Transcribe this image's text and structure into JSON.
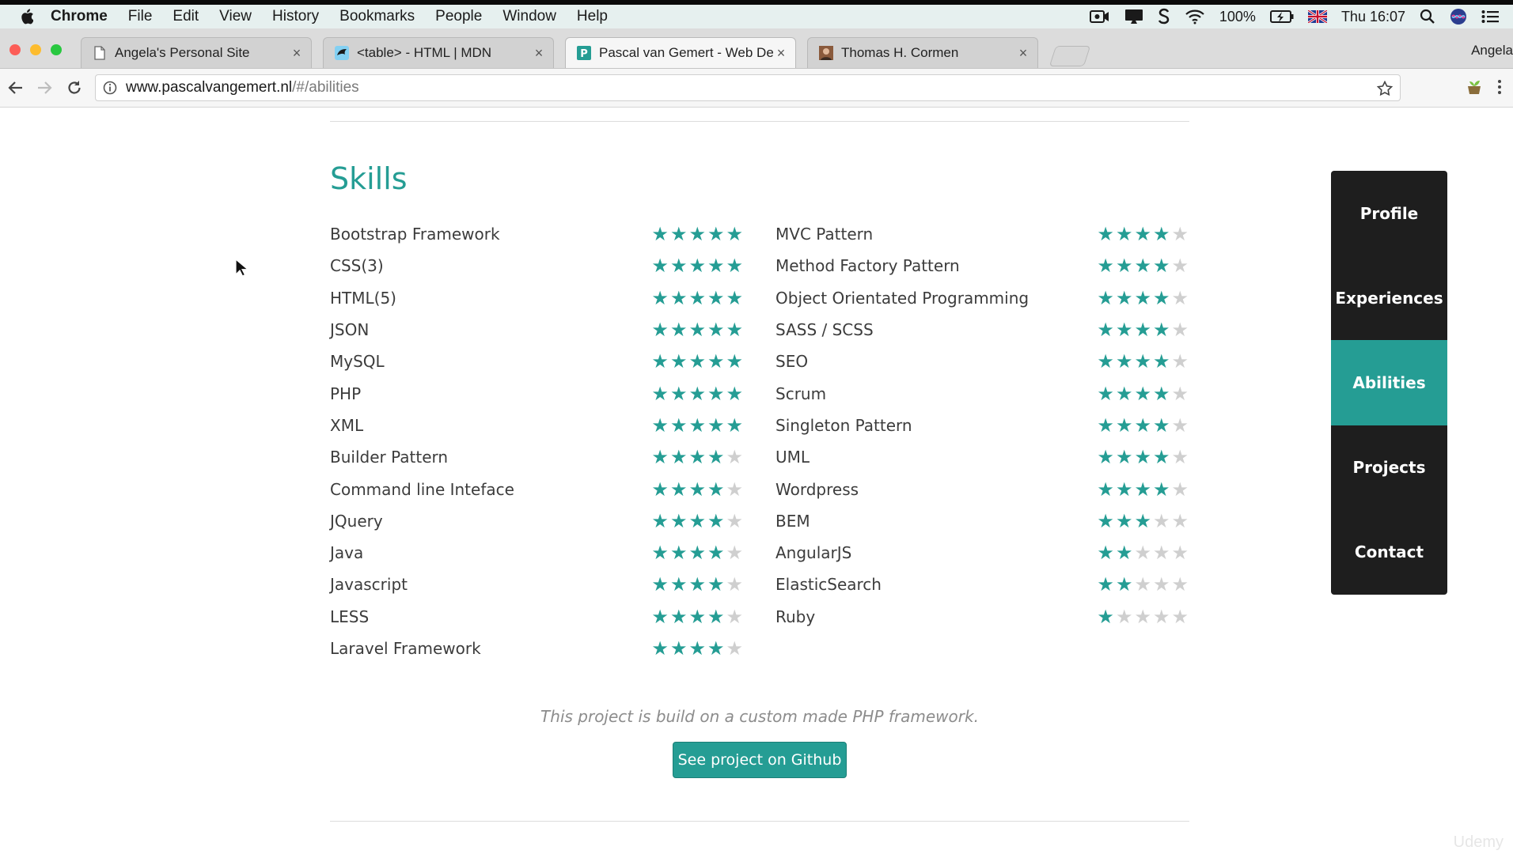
{
  "menubar": {
    "app_name": "Chrome",
    "items": [
      "File",
      "Edit",
      "View",
      "History",
      "Bookmarks",
      "People",
      "Window",
      "Help"
    ],
    "battery": "100%",
    "clock": "Thu 16:07"
  },
  "tabs": [
    {
      "title": "Angela's Personal Site",
      "active": false
    },
    {
      "title": "<table> - HTML | MDN",
      "active": false
    },
    {
      "title": "Pascal van Gemert - Web Developer",
      "active": true
    },
    {
      "title": "Thomas H. Cormen",
      "active": false
    }
  ],
  "profile_name": "Angela",
  "address": {
    "host": "www.pascalvangemert.nl",
    "path": "/#/abilities"
  },
  "colors": {
    "accent": "#259d94",
    "star_empty": "#cfcfcf",
    "nav_bg": "#1e1e1e"
  },
  "section_title": "Skills",
  "skills_left": [
    {
      "name": "Bootstrap Framework",
      "rating": 5
    },
    {
      "name": "CSS(3)",
      "rating": 5
    },
    {
      "name": "HTML(5)",
      "rating": 5
    },
    {
      "name": "JSON",
      "rating": 5
    },
    {
      "name": "MySQL",
      "rating": 5
    },
    {
      "name": "PHP",
      "rating": 5
    },
    {
      "name": "XML",
      "rating": 5
    },
    {
      "name": "Builder Pattern",
      "rating": 4
    },
    {
      "name": "Command line Inteface",
      "rating": 4
    },
    {
      "name": "JQuery",
      "rating": 4
    },
    {
      "name": "Java",
      "rating": 4
    },
    {
      "name": "Javascript",
      "rating": 4
    },
    {
      "name": "LESS",
      "rating": 4
    },
    {
      "name": "Laravel Framework",
      "rating": 4
    }
  ],
  "skills_right": [
    {
      "name": "MVC Pattern",
      "rating": 4
    },
    {
      "name": "Method Factory Pattern",
      "rating": 4
    },
    {
      "name": "Object Orientated Programming",
      "rating": 4
    },
    {
      "name": "SASS / SCSS",
      "rating": 4
    },
    {
      "name": "SEO",
      "rating": 4
    },
    {
      "name": "Scrum",
      "rating": 4
    },
    {
      "name": "Singleton Pattern",
      "rating": 4
    },
    {
      "name": "UML",
      "rating": 4
    },
    {
      "name": "Wordpress",
      "rating": 4
    },
    {
      "name": "BEM",
      "rating": 3
    },
    {
      "name": "AngularJS",
      "rating": 2
    },
    {
      "name": "ElasticSearch",
      "rating": 2
    },
    {
      "name": "Ruby",
      "rating": 1
    }
  ],
  "project_note": "This project is build on a custom made PHP framework.",
  "github_button": "See project on Github",
  "sidenav": [
    {
      "label": "Profile",
      "active": false
    },
    {
      "label": "Experiences",
      "active": false
    },
    {
      "label": "Abilities",
      "active": true
    },
    {
      "label": "Projects",
      "active": false
    },
    {
      "label": "Contact",
      "active": false
    }
  ],
  "watermark": "Udemy"
}
